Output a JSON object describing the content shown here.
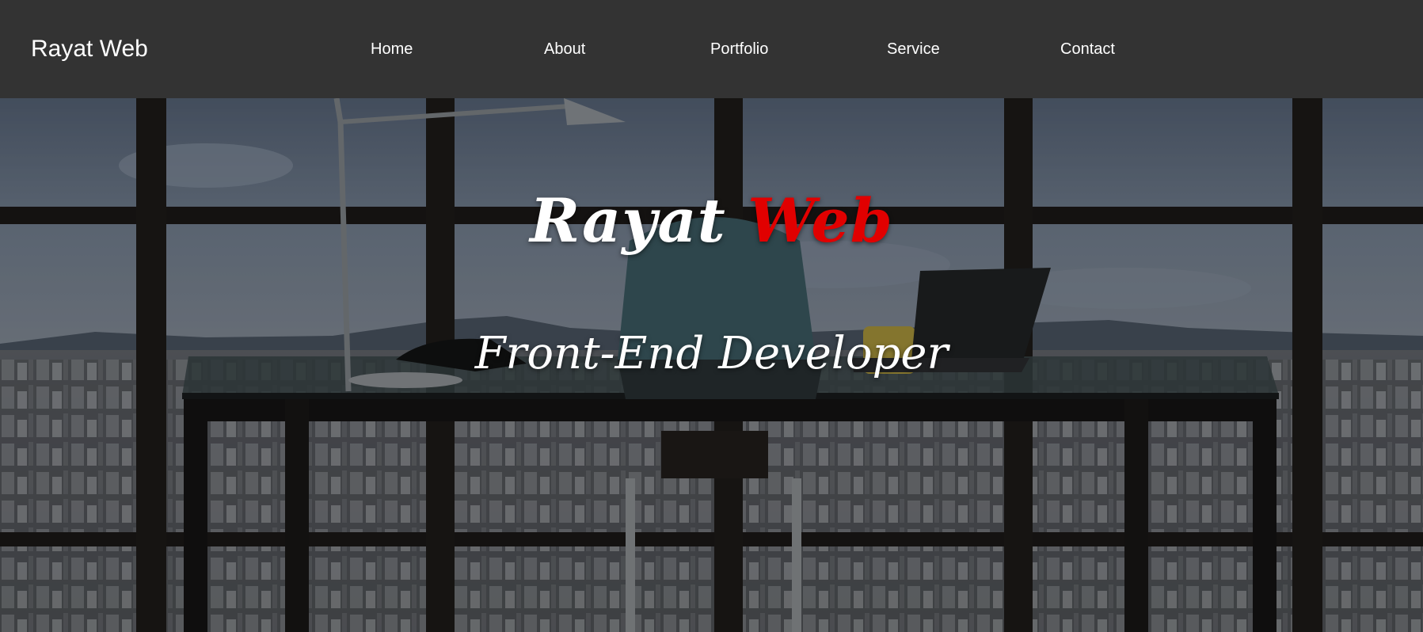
{
  "nav": {
    "brand": "Rayat Web",
    "links": [
      {
        "label": "Home"
      },
      {
        "label": "About"
      },
      {
        "label": "Portfolio"
      },
      {
        "label": "Service"
      },
      {
        "label": "Contact"
      }
    ]
  },
  "hero": {
    "title_part1": "Rayat",
    "title_part2": "Web",
    "subtitle": "Front-End Developer"
  },
  "colors": {
    "navbar_bg": "#333333",
    "nav_text": "#ffffff",
    "accent": "#e10000"
  }
}
